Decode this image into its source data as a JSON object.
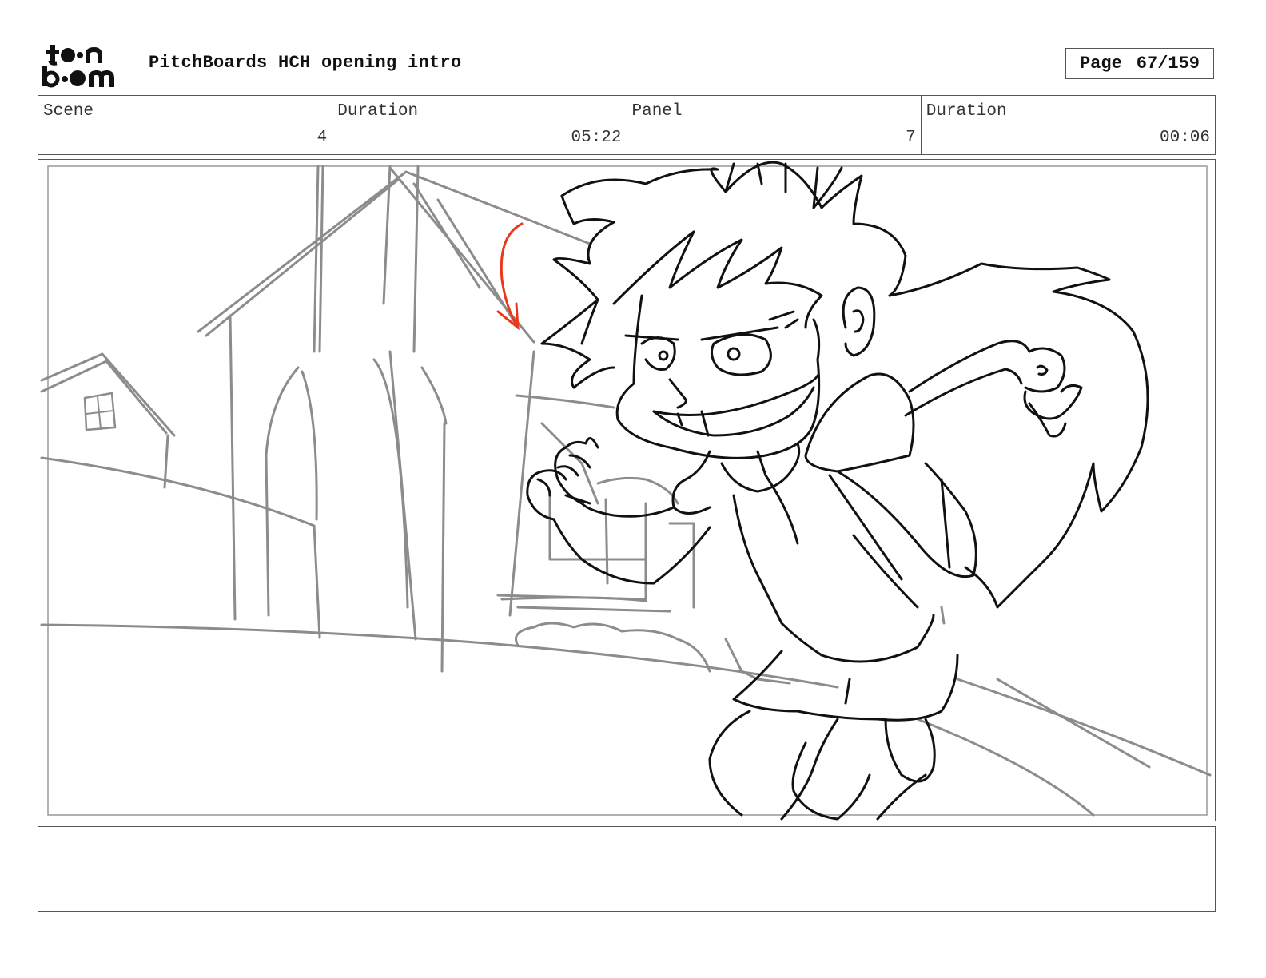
{
  "header": {
    "logo_lines": [
      "toon",
      "boom"
    ],
    "title": "PitchBoards HCH opening intro",
    "page_label": "Page",
    "page_value": "67/159"
  },
  "info": {
    "scene_label": "Scene",
    "scene_value": "4",
    "scene_duration_label": "Duration",
    "scene_duration_value": "05:22",
    "panel_label": "Panel",
    "panel_value": "7",
    "panel_duration_label": "Duration",
    "panel_duration_value": "00:06"
  },
  "panel": {
    "sketch_description": "rough pencil sketch of girl running past houses",
    "colors": {
      "background_lines": "#8c8c8c",
      "character_lines": "#111111",
      "direction_arrow": "#e8391d"
    }
  },
  "notes": {
    "text": ""
  }
}
